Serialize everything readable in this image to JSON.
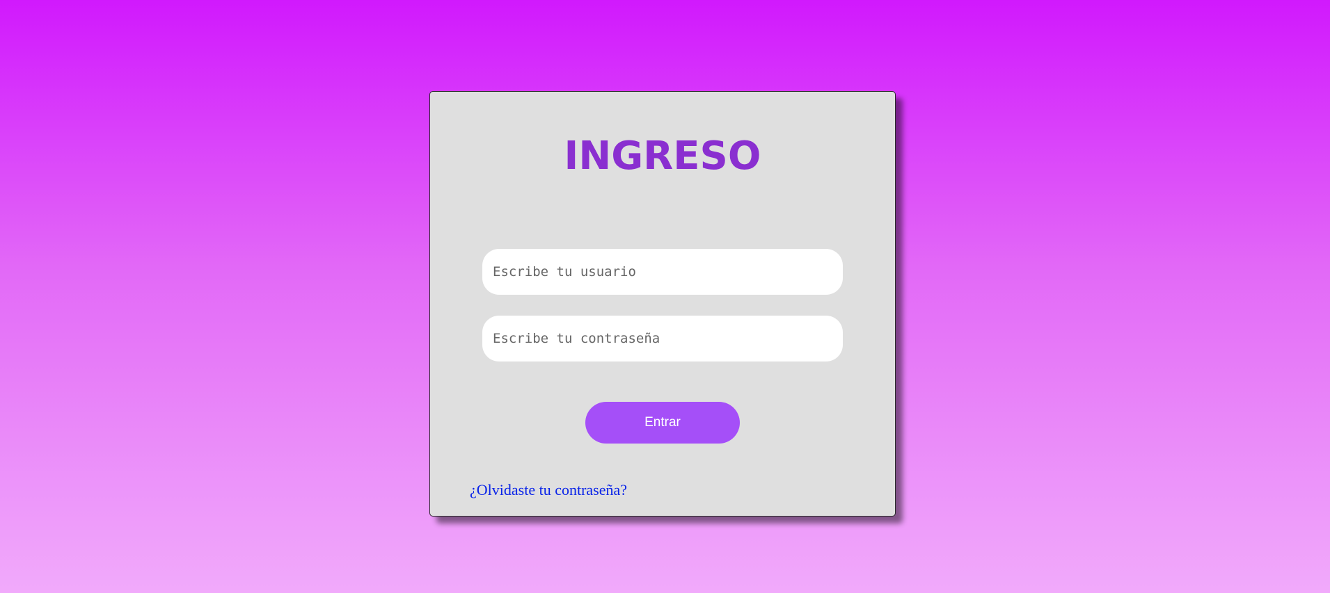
{
  "login": {
    "title": "INGRESO",
    "username_placeholder": "Escribe tu usuario",
    "username_value": "",
    "password_placeholder": "Escribe tu contraseña",
    "password_value": "",
    "submit_label": "Entrar",
    "forgot_link": "¿Olvidaste tu contraseña?"
  },
  "colors": {
    "background_top": "#d119fd",
    "background_bottom": "#f1aafb",
    "card": "#dfdfdf",
    "title": "#8a2fd0",
    "button": "#a54ff8",
    "link": "#0a24e8"
  }
}
